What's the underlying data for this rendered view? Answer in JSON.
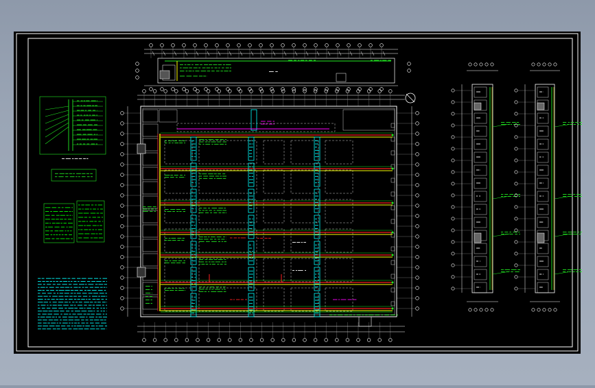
{
  "viewer": {
    "background": "#9aa5b5",
    "sheet_color": "#000000",
    "frame_color": "#ffffff"
  },
  "colors": {
    "white": "#ffffff",
    "grid_gray": "#9a9a9a",
    "green": "#22ee22",
    "bright_green": "#00ff00",
    "yellow": "#ffff00",
    "red": "#ff2020",
    "cyan": "#00ffff",
    "magenta": "#ff00ff"
  },
  "drawing": {
    "top_strip_label": "",
    "north_symbol": "north-arrow-icon",
    "legend_note_icon": "text-block-icon"
  }
}
